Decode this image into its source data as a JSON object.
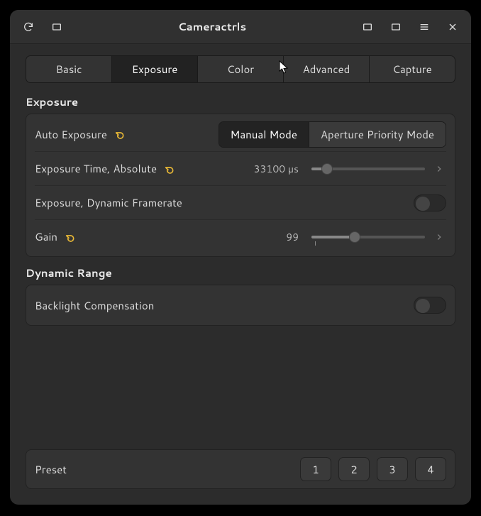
{
  "title": "Cameractrls",
  "tabs": [
    {
      "label": "Basic"
    },
    {
      "label": "Exposure"
    },
    {
      "label": "Color"
    },
    {
      "label": "Advanced"
    },
    {
      "label": "Capture"
    }
  ],
  "active_tab_index": 1,
  "sections": {
    "exposure": {
      "title": "Exposure",
      "auto_exposure": {
        "label": "Auto Exposure",
        "options": [
          "Manual Mode",
          "Aperture Priority Mode"
        ],
        "active_index": 0
      },
      "exposure_time": {
        "label": "Exposure Time, Absolute",
        "value_display": "33100 µs",
        "slider_percent": 14
      },
      "dynamic_framerate": {
        "label": "Exposure, Dynamic Framerate",
        "on": false
      },
      "gain": {
        "label": "Gain",
        "value_display": "99",
        "slider_percent": 38,
        "tick_percent": 3
      }
    },
    "dynamic_range": {
      "title": "Dynamic Range",
      "backlight": {
        "label": "Backlight Compensation",
        "on": false
      }
    }
  },
  "footer": {
    "label": "Preset",
    "buttons": [
      "1",
      "2",
      "3",
      "4"
    ]
  },
  "colors": {
    "reset_icon": "#e8b836"
  }
}
